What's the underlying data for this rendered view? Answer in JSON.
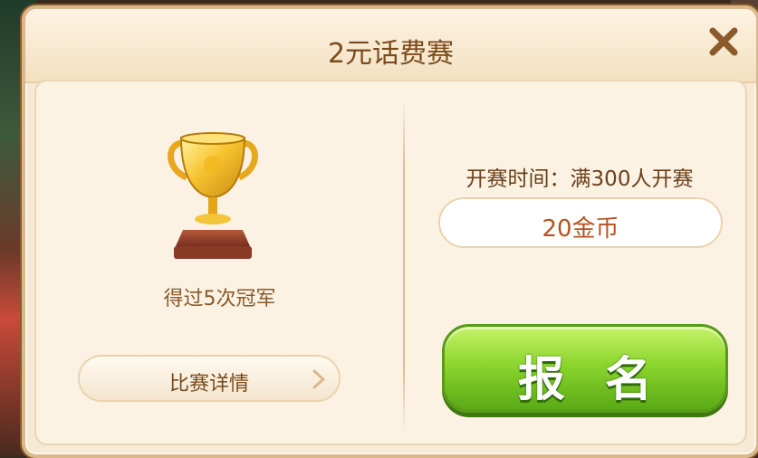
{
  "dialog": {
    "title": "2元话费赛",
    "close_icon": "close-icon"
  },
  "left_panel": {
    "trophy_icon": "trophy-icon",
    "champion_text": "得过5次冠军",
    "details_button_label": "比赛详情",
    "details_icon": "chevron-right-icon"
  },
  "right_panel": {
    "start_time_text": "开赛时间：满300人开赛",
    "entry_fee": "20金币",
    "signup_button_label": "报名"
  },
  "colors": {
    "title_brown": "#7a4a1c",
    "fee_orange": "#b5531e",
    "signup_green": "#8cd62e"
  }
}
